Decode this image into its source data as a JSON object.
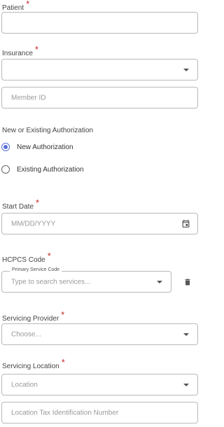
{
  "patient": {
    "label": "Patient",
    "required_mark": "*"
  },
  "insurance": {
    "label": "Insurance",
    "required_mark": "*",
    "member_id_placeholder": "Member ID"
  },
  "authorization": {
    "label": "New or Existing Authorization",
    "options": [
      {
        "label": "New Authorization",
        "selected": true
      },
      {
        "label": "Existing Authorization",
        "selected": false
      }
    ]
  },
  "start_date": {
    "label": "Start Date",
    "required_mark": "*",
    "placeholder": "MM/DD/YYYY",
    "icon": "calendar-icon"
  },
  "hcpcs": {
    "label": "HCPCS Code",
    "required_mark": "*",
    "float_label": "Primary Service Code",
    "placeholder": "Type to search services...",
    "delete_icon": "trash-icon"
  },
  "servicing_provider": {
    "label": "Servicing Provider",
    "required_mark": "*",
    "placeholder": "Choose..."
  },
  "servicing_location": {
    "label": "Servicing Location",
    "required_mark": "*",
    "location_placeholder": "Location",
    "tax_id_placeholder": "Location Tax Identification Number"
  },
  "colors": {
    "accent": "#5b6ed6",
    "required": "#c62828",
    "border": "#b9b9b9"
  }
}
